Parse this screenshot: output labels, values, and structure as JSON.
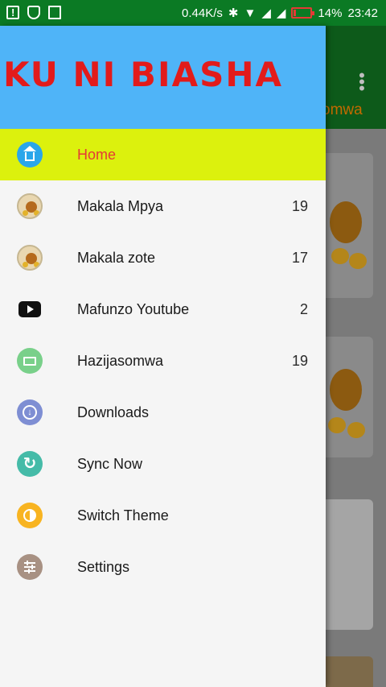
{
  "status_bar": {
    "network_speed": "0.44K/s",
    "battery_percent": "14%",
    "time": "23:42",
    "battery_level": 0.14,
    "icons": [
      "alert-icon",
      "shield-icon",
      "image-icon",
      "bluetooth-icon",
      "wifi-icon",
      "signal-icon",
      "signal-icon",
      "battery-icon"
    ]
  },
  "drawer": {
    "banner_text": "KU NI BIASHA",
    "items": [
      {
        "label": "Home",
        "count": "",
        "icon": "home-icon",
        "active": true
      },
      {
        "label": "Makala Mpya",
        "count": "19",
        "icon": "avatar-icon"
      },
      {
        "label": "Makala zote",
        "count": "17",
        "icon": "avatar-icon"
      },
      {
        "label": "Mafunzo Youtube",
        "count": "2",
        "icon": "youtube-icon"
      },
      {
        "label": "Hazijasomwa",
        "count": "19",
        "icon": "mail-icon"
      },
      {
        "label": "Downloads",
        "count": "",
        "icon": "download-icon"
      },
      {
        "label": "Sync Now",
        "count": "",
        "icon": "sync-icon"
      },
      {
        "label": "Switch Theme",
        "count": "",
        "icon": "theme-icon"
      },
      {
        "label": "Settings",
        "count": "",
        "icon": "settings-icon"
      }
    ]
  },
  "background": {
    "tab_partial": "omwa"
  },
  "colors": {
    "status_bar": "#0b7a24",
    "header": "#4fb4f8",
    "banner_text": "#e21b1b",
    "active_item": "#dcf10d",
    "active_label": "#e53935"
  }
}
